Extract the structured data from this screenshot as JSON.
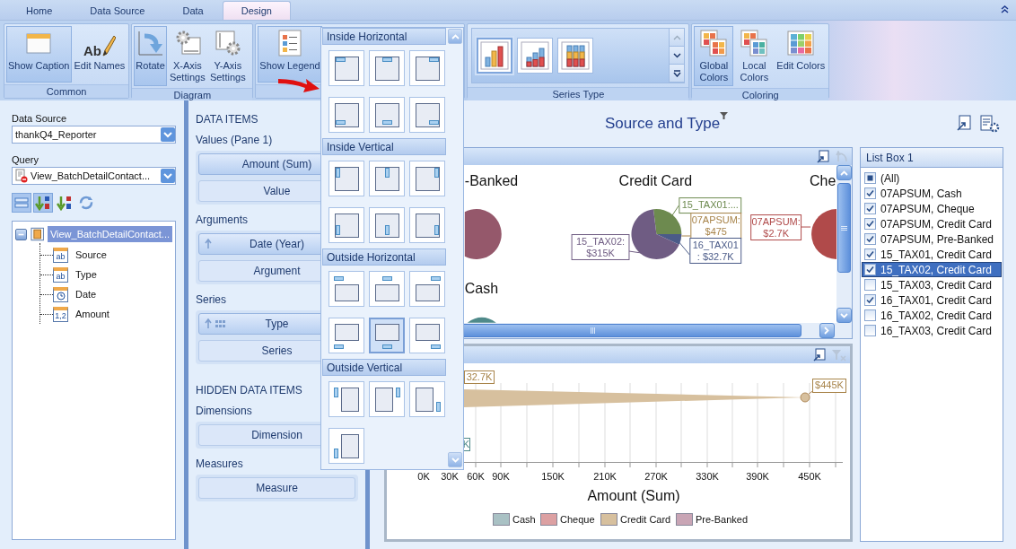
{
  "ribbon_tabs": [
    {
      "label": "Home",
      "selected": false
    },
    {
      "label": "Data Source",
      "selected": false
    },
    {
      "label": "Data",
      "selected": false
    },
    {
      "label": "Design",
      "selected": true
    }
  ],
  "ribbon_groups": [
    {
      "kind": "buttons",
      "caption": "Common",
      "buttons": [
        {
          "label": "Show Caption",
          "kind": "caption",
          "pressed": true
        },
        {
          "label": "Edit Names",
          "kind": "rename",
          "icon_text": "Ab",
          "pressed": false
        }
      ]
    },
    {
      "kind": "buttons",
      "caption": "Diagram",
      "buttons": [
        {
          "label": "Rotate",
          "kind": "rotate",
          "pressed": true
        },
        {
          "label": "X-Axis Settings",
          "kind": "x-axis",
          "pressed": false
        },
        {
          "label": "Y-Axis Settings",
          "kind": "y-axis",
          "pressed": false
        }
      ]
    },
    {
      "kind": "buttons",
      "buttons": [
        {
          "label": "Show Legend",
          "kind": "legend",
          "pressed": true
        }
      ]
    },
    {
      "kind": "gallery",
      "caption": "Series Type",
      "items": [
        {
          "kind": "bar",
          "selected": true
        },
        {
          "kind": "stacked",
          "selected": false
        },
        {
          "kind": "full-stacked",
          "selected": false
        }
      ]
    },
    {
      "kind": "buttons",
      "caption": "Coloring",
      "buttons": [
        {
          "label": "Global Colors",
          "kind": "global-colors",
          "pressed": true
        },
        {
          "label": "Local Colors",
          "kind": "local-colors",
          "pressed": false
        },
        {
          "label": "Edit Colors",
          "kind": "edit-colors",
          "pressed": false
        }
      ]
    }
  ],
  "data_source_panel": {
    "data_source_label": "Data Source",
    "data_source": "thankQ4_Reporter",
    "query_label": "Query",
    "query": "View_BatchDetailContact...",
    "toolbar": [
      {
        "kind": "collapse",
        "pressed": true
      },
      {
        "kind": "sort-ascending",
        "pressed": true
      },
      {
        "kind": "sort-descending",
        "pressed": false
      },
      {
        "kind": "refresh",
        "pressed": false
      }
    ],
    "tree": [
      {
        "label": "View_BatchDetailContact...",
        "kind": "table",
        "expanded": true,
        "selected": true,
        "children": [
          {
            "label": "Source",
            "kind": "text",
            "icon_text": "ab"
          },
          {
            "label": "Type",
            "kind": "text",
            "icon_text": "ab"
          },
          {
            "label": "Date",
            "kind": "date"
          },
          {
            "label": "Amount",
            "kind": "number",
            "icon_text": "1,2"
          }
        ]
      }
    ]
  },
  "data_items_panel": {
    "sections": [
      {
        "heading": "DATA ITEMS",
        "groups": [
          {
            "label": "Values (Pane 1)",
            "items": [
              {
                "text": "Amount (Sum)",
                "kind": "measure"
              },
              {
                "text": "Value",
                "kind": "placeholder"
              }
            ]
          },
          {
            "label": "Arguments",
            "items": [
              {
                "text": "Date (Year)",
                "kind": "dimension"
              },
              {
                "text": "Argument",
                "kind": "placeholder"
              }
            ]
          },
          {
            "label": "Series",
            "items": [
              {
                "text": "Type",
                "kind": "series-dimension"
              },
              {
                "text": "Series",
                "kind": "placeholder"
              }
            ]
          }
        ]
      },
      {
        "heading": "HIDDEN DATA ITEMS",
        "groups": [
          {
            "label": "Dimensions",
            "items": [
              {
                "text": "Dimension",
                "kind": "placeholder"
              }
            ]
          },
          {
            "label": "Measures",
            "items": [
              {
                "text": "Measure",
                "kind": "placeholder"
              }
            ]
          }
        ]
      }
    ]
  },
  "legend_gallery": {
    "sections": [
      {
        "title": "Inside Horizontal",
        "kind": "inside-horizontal",
        "items": [
          {
            "selected": false
          },
          {
            "selected": false
          },
          {
            "selected": false
          },
          {
            "selected": false
          },
          {
            "selected": false
          },
          {
            "selected": false
          }
        ]
      },
      {
        "title": "Inside Vertical",
        "kind": "inside-vertical",
        "items": [
          {
            "selected": false
          },
          {
            "selected": false
          },
          {
            "selected": false
          },
          {
            "selected": false
          },
          {
            "selected": false
          },
          {
            "selected": false
          }
        ]
      },
      {
        "title": "Outside Horizontal",
        "kind": "outside-horizontal",
        "items": [
          {
            "selected": false
          },
          {
            "selected": false
          },
          {
            "selected": false
          },
          {
            "selected": false
          },
          {
            "selected": true
          },
          {
            "selected": false
          }
        ]
      },
      {
        "title": "Outside Vertical",
        "kind": "outside-vertical",
        "items": [
          {
            "selected": false
          },
          {
            "selected": false
          },
          {
            "selected": false
          },
          {
            "selected": false
          }
        ]
      }
    ]
  },
  "dashboard": {
    "title": "Source and Type",
    "pie_pane": {
      "titles": [
        "-Banked",
        "Credit Card",
        "Che",
        "Cash"
      ],
      "slice_labels": [
        {
          "lines": [
            "15_TAX02:",
            "$315K"
          ],
          "color": "#6f5c83"
        },
        {
          "lines": [
            "15_TAX01:..."
          ],
          "color": "#6d8a4f"
        },
        {
          "lines": [
            "07APSUM:",
            "$475"
          ],
          "color": "#a8844a"
        },
        {
          "lines": [
            "16_TAX01",
            ": $32.7K"
          ],
          "color": "#4b5b88"
        },
        {
          "lines": [
            "07APSUM:",
            "$2.7K"
          ],
          "color": "#b04a4a"
        }
      ]
    },
    "area_pane": {
      "point_labels": [
        "32.7K",
        "$445K",
        "K"
      ],
      "x_ticks": [
        "0K",
        "30K",
        "60K",
        "90K",
        "150K",
        "210K",
        "270K",
        "330K",
        "390K",
        "450K"
      ],
      "x_title": "Amount (Sum)",
      "legend": [
        {
          "name": "Cash",
          "color": "#a9c1c4"
        },
        {
          "name": "Cheque",
          "color": "#dca0a2"
        },
        {
          "name": "Credit Card",
          "color": "#d7c09e"
        },
        {
          "name": "Pre-Banked",
          "color": "#c9a5b5"
        }
      ]
    }
  },
  "list_box": {
    "title": "List Box 1",
    "items": [
      {
        "label": "(All)",
        "checked": true,
        "partial": true,
        "selected": false
      },
      {
        "label": "07APSUM, Cash",
        "checked": true,
        "selected": false
      },
      {
        "label": "07APSUM, Cheque",
        "checked": true,
        "selected": false
      },
      {
        "label": "07APSUM, Credit Card",
        "checked": true,
        "selected": false
      },
      {
        "label": "07APSUM, Pre-Banked",
        "checked": true,
        "selected": false
      },
      {
        "label": "15_TAX01, Credit Card",
        "checked": true,
        "selected": false
      },
      {
        "label": "15_TAX02, Credit Card",
        "checked": true,
        "selected": true
      },
      {
        "label": "15_TAX03, Credit Card",
        "checked": false,
        "selected": false
      },
      {
        "label": "16_TAX01, Credit Card",
        "checked": true,
        "selected": false
      },
      {
        "label": "16_TAX02, Credit Card",
        "checked": false,
        "selected": false
      },
      {
        "label": "16_TAX03, Credit Card",
        "checked": false,
        "selected": false
      }
    ]
  }
}
